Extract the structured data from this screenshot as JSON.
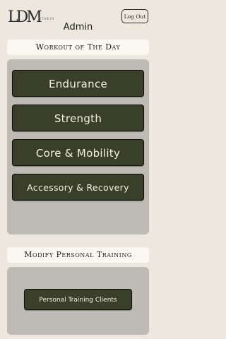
{
  "header": {
    "logo_text": "LDM",
    "logo_sub": "FITNESS",
    "title": "Admin",
    "logout_label": "Log Out"
  },
  "wod": {
    "section_title": "Workout of The Day",
    "buttons": [
      {
        "label": "Endurance"
      },
      {
        "label": "Strength"
      },
      {
        "label": "Core & Mobility"
      },
      {
        "label": "Accessory & Recovery"
      }
    ]
  },
  "pt": {
    "section_title": "Modify Personal Training",
    "clients_label": "Personal Training Clients"
  }
}
